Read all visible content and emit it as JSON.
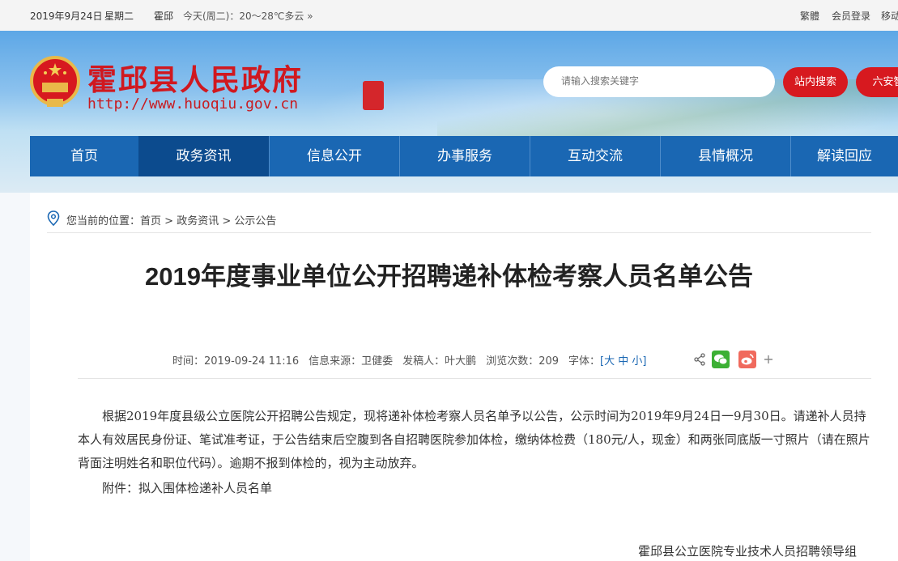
{
  "topbar": {
    "date": "2019年9月24日",
    "weekday": "星期二",
    "city": "霍邱",
    "weather": "今天(周二)：20～28℃多云 »",
    "traditional": "繁體",
    "login": "会员登录",
    "mobile": "移动"
  },
  "header": {
    "site_title": "霍邱县人民政府",
    "site_url": "http://www.huoqiu.gov.cn",
    "search_placeholder": "请输入搜索关键字",
    "search_site_label": "站内搜索",
    "search_lu_an_label": "六安智"
  },
  "nav": {
    "items": [
      "首页",
      "政务资讯",
      "信息公开",
      "办事服务",
      "互动交流",
      "县情概况",
      "解读回应"
    ],
    "active_index": 1
  },
  "breadcrumb": {
    "prefix": "您当前的位置：",
    "home": "首页",
    "sep1": " > ",
    "section": "政务资讯",
    "sep2": " > ",
    "current": "公示公告"
  },
  "article": {
    "title": "2019年度事业单位公开招聘递补体检考察人员名单公告",
    "meta": {
      "time": "时间：2019-09-24 11:16",
      "source": "信息来源：卫健委",
      "author": "发稿人：叶大鹏",
      "views": "浏览次数：209",
      "font_label": "字体：",
      "font_size": "[大 中 小]"
    },
    "paragraph": "根据2019年度县级公立医院公开招聘公告规定，现将递补体检考察人员名单予以公告，公示时间为2019年9月24日一9月30日。请递补人员持本人有效居民身份证、笔试准考证，于公告结束后空腹到各自招聘医院参加体检，缴纳体检费（180元/人，现金）和两张同底版一寸照片（请在照片背面注明姓名和职位代码）。逾期不报到体检的，视为主动放弃。",
    "attachment": "附件：拟入围体检递补人员名单",
    "signature": "霍邱县公立医院专业技术人员招聘领导组"
  },
  "colors": {
    "brand_red": "#d7191f",
    "nav_blue": "#1a67b3",
    "nav_active": "#0c4b8e"
  }
}
